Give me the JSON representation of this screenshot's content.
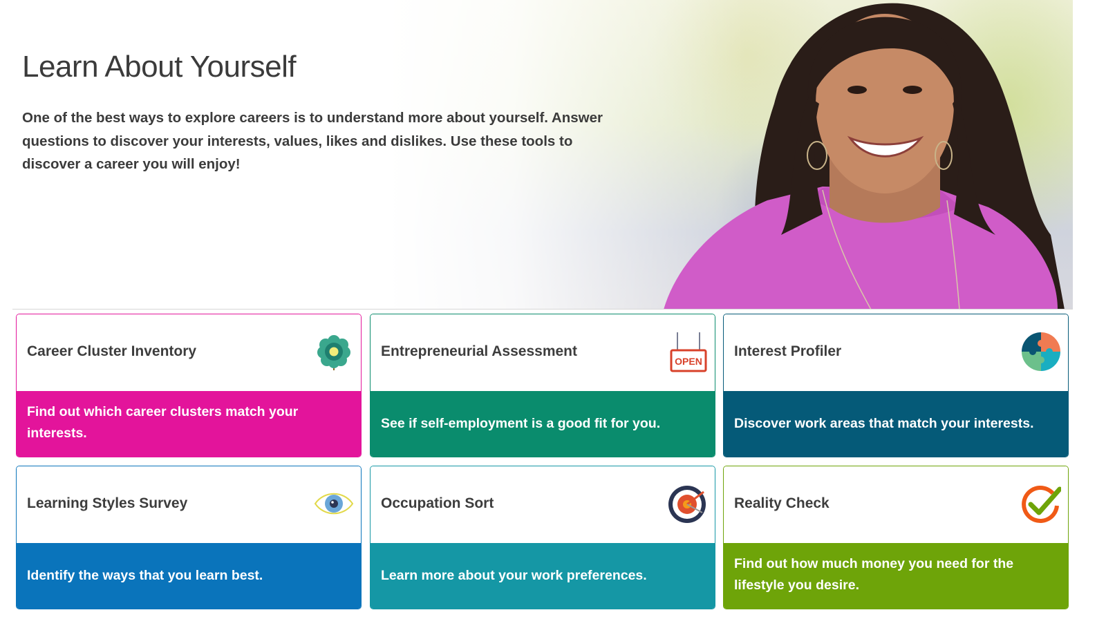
{
  "hero": {
    "title": "Learn About Yourself",
    "description": "One of the best ways to explore careers is to understand more about yourself. Answer questions to discover your interests, values, likes and dislikes. Use these tools to discover a career you will enjoy!",
    "image": "smiling-woman-portrait"
  },
  "cards": [
    {
      "title": "Career Cluster Inventory",
      "description": "Find out which career clusters match your interests.",
      "icon": "flower-icon",
      "color": "#e3149b"
    },
    {
      "title": "Entrepreneurial Assessment",
      "description": "See if self-employment is a good fit for you.",
      "icon": "open-sign-icon",
      "icon_text": "OPEN",
      "color": "#0a8c6d"
    },
    {
      "title": "Interest Profiler",
      "description": "Discover work areas that match your interests.",
      "icon": "puzzle-icon",
      "color": "#055a78"
    },
    {
      "title": "Learning Styles Survey",
      "description": "Identify the ways that you learn best.",
      "icon": "eye-icon",
      "color": "#0a74bb"
    },
    {
      "title": "Occupation Sort",
      "description": "Learn more about your work preferences.",
      "icon": "target-icon",
      "color": "#1597a5"
    },
    {
      "title": "Reality Check",
      "description": "Find out how much money you need for the lifestyle you desire.",
      "icon": "checkmark-icon",
      "color": "#6ea409"
    }
  ]
}
